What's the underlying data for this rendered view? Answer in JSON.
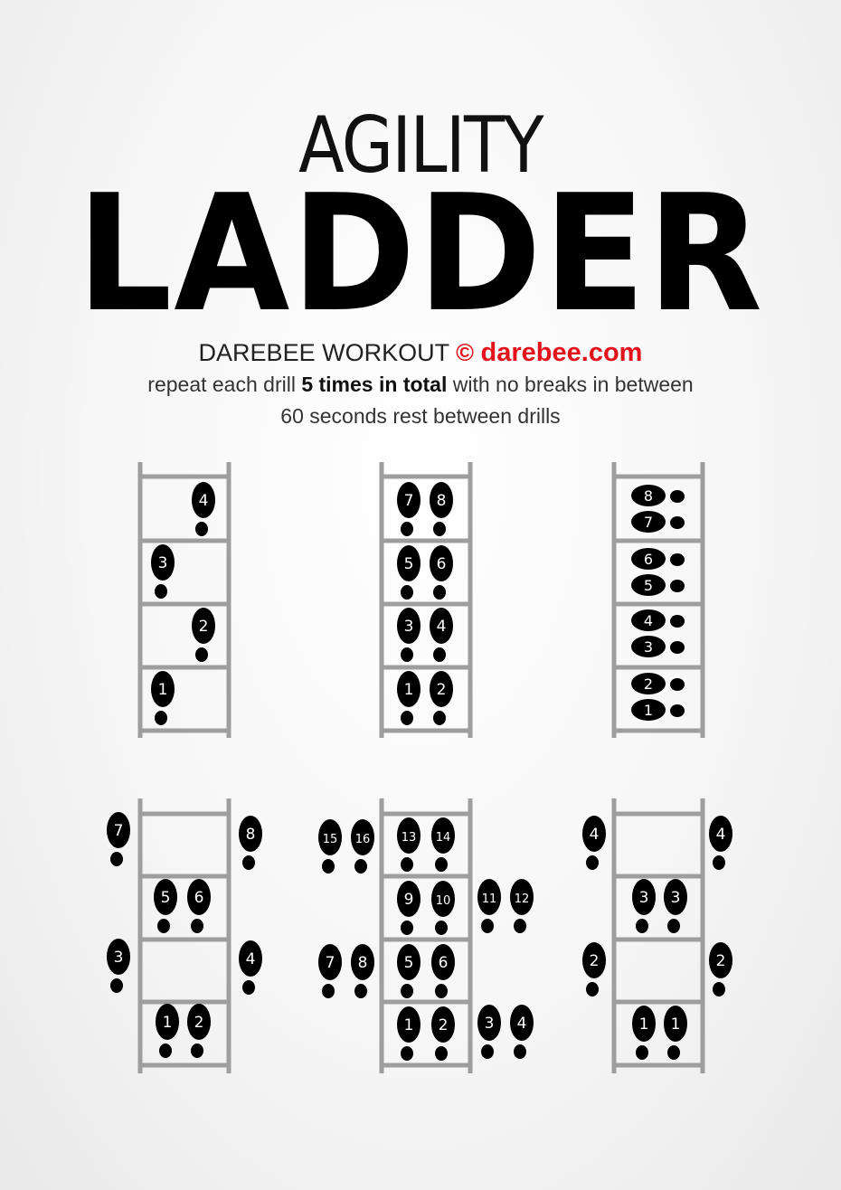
{
  "header": {
    "title_top": "AGILITY",
    "title_main": "LADDER",
    "brand_prefix": "DAREBEE WORKOUT",
    "brand_symbol": "©",
    "brand_url": "darebee.com",
    "instruction_pre": "repeat each drill",
    "instruction_bold": "5 times in total",
    "instruction_post": "with no breaks in between",
    "rest_note": "60 seconds rest between drills"
  },
  "colors": {
    "ladder": "#9e9e9e",
    "footprint": "#000000",
    "footprint_number": "#ffffff",
    "accent": "#e3131b"
  },
  "drills": [
    {
      "steps": [
        "4",
        "3",
        "2",
        "1"
      ]
    },
    {
      "steps": [
        "7",
        "8",
        "5",
        "6",
        "3",
        "4",
        "1",
        "2"
      ]
    },
    {
      "steps": [
        "8",
        "7",
        "6",
        "5",
        "4",
        "3",
        "2",
        "1"
      ]
    },
    {
      "steps": [
        "7",
        "8",
        "5",
        "6",
        "3",
        "4",
        "1",
        "2"
      ]
    },
    {
      "steps": [
        "15",
        "16",
        "13",
        "14",
        "9",
        "10",
        "11",
        "12",
        "7",
        "8",
        "5",
        "6",
        "1",
        "2",
        "3",
        "4"
      ]
    },
    {
      "steps": [
        "4",
        "4",
        "3",
        "3",
        "2",
        "2",
        "1",
        "1"
      ]
    }
  ]
}
